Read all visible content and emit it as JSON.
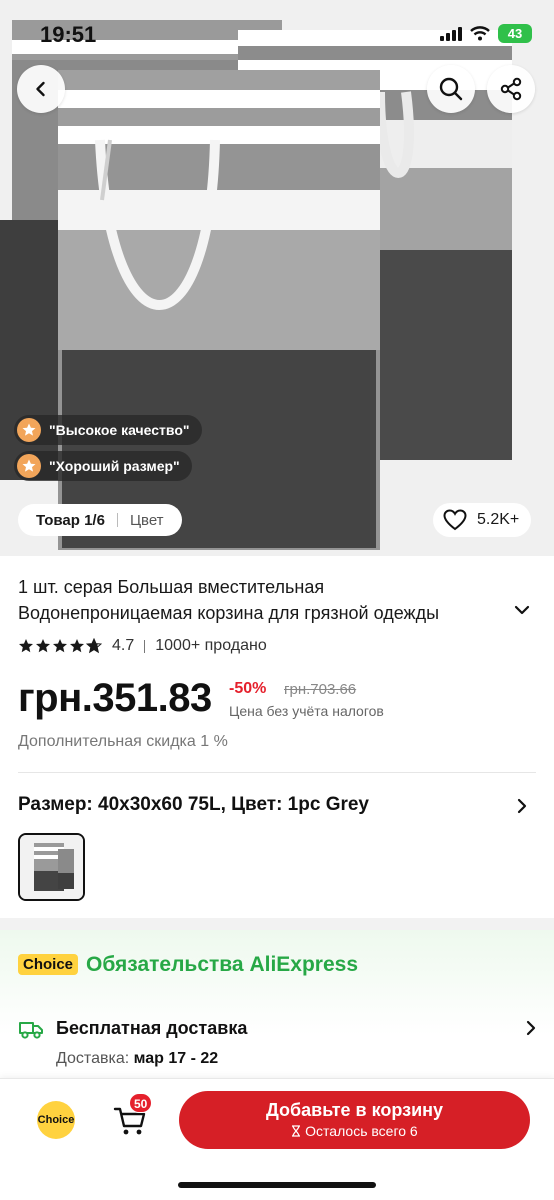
{
  "status_bar": {
    "time": "19:51",
    "battery": "43"
  },
  "gallery": {
    "badges": [
      "\"Высокое качество\"",
      "\"Хороший размер\""
    ],
    "counter": "Товар 1/6",
    "color_label": "Цвет",
    "favorites_count": "5.2K+"
  },
  "product": {
    "title_line1": "1 шт. серая Большая вместительная",
    "title_line2": "Водонепроницаемая корзина для грязной одежды",
    "rating": "4.7",
    "sold": "1000+ продано",
    "price": "грн.351.83",
    "discount": "-50%",
    "old_price": "грн.703.66",
    "tax_note": "Цена без учёта налогов",
    "extra_discount": "Дополнительная скидка 1 %",
    "variant": "Размер: 40x30x60 75L, Цвет: 1pc Grey"
  },
  "choice": {
    "tag": "Choice",
    "title": "Обязательства AliExpress",
    "shipping_title": "Бесплатная доставка",
    "shipping_label": "Доставка: ",
    "shipping_dates": "мар 17 - 22"
  },
  "bottom_bar": {
    "choice_label": "Choice",
    "cart_count": "50",
    "add_to_cart": "Добавьте в корзину",
    "stock_note": "Осталось всего 6"
  },
  "colors": {
    "price_red": "#e5202c",
    "button_red": "#d61f26",
    "choice_yellow": "#ffd23f",
    "choice_green": "#27a846",
    "rating_stars": 4.7
  },
  "icons": [
    "back-arrow-icon",
    "search-icon",
    "share-icon",
    "star-badge-icon",
    "heart-icon",
    "chevron-down-icon",
    "chevron-right-icon",
    "truck-icon",
    "cart-icon",
    "hourglass-icon"
  ]
}
